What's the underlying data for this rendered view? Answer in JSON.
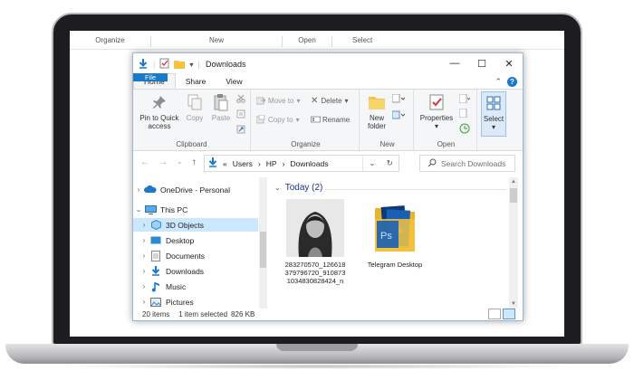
{
  "background_ribbon": {
    "groups": [
      "Organize",
      "New",
      "Open",
      "Select"
    ]
  },
  "window": {
    "title": "Downloads",
    "controls": {
      "minimize": "—",
      "maximize": "☐",
      "close": "✕"
    }
  },
  "tabs": {
    "file": "File",
    "home": "Home",
    "share": "Share",
    "view": "View",
    "collapse": "⌃",
    "help": "?"
  },
  "ribbon": {
    "clipboard": {
      "label": "Clipboard",
      "pin_line1": "Pin to Quick",
      "pin_line2": "access",
      "copy": "Copy",
      "paste": "Paste"
    },
    "organize": {
      "label": "Organize",
      "move_to": "Move to",
      "copy_to": "Copy to",
      "delete": "Delete",
      "rename": "Rename"
    },
    "new": {
      "label": "New",
      "new_folder_line1": "New",
      "new_folder_line2": "folder"
    },
    "open": {
      "label": "Open",
      "properties": "Properties"
    },
    "select": {
      "label": "Select"
    }
  },
  "address": {
    "prefix": "«",
    "crumbs": [
      "Users",
      "HP",
      "Downloads"
    ],
    "sep": "›",
    "search_placeholder": "Search Downloads"
  },
  "nav_tree": [
    {
      "label": "OneDrive - Personal",
      "icon": "cloud-icon"
    },
    {
      "label": "This PC",
      "icon": "computer-icon"
    },
    {
      "label": "3D Objects",
      "icon": "cube-icon"
    },
    {
      "label": "Desktop",
      "icon": "desktop-icon"
    },
    {
      "label": "Documents",
      "icon": "document-icon"
    },
    {
      "label": "Downloads",
      "icon": "download-icon"
    },
    {
      "label": "Music",
      "icon": "music-icon"
    },
    {
      "label": "Pictures",
      "icon": "pictures-icon"
    }
  ],
  "content": {
    "group_header": "Today (2)",
    "files": [
      {
        "name": "283270570_126618379796720_9108731034830828424_n",
        "type": "image"
      },
      {
        "name": "Telegram Desktop",
        "type": "folder"
      }
    ]
  },
  "status": {
    "items": "20 items",
    "selection": "1 item selected",
    "size": "826 KB"
  },
  "colors": {
    "accent": "#1979ca",
    "selection": "#cce8ff",
    "group_header": "#1e3287"
  }
}
